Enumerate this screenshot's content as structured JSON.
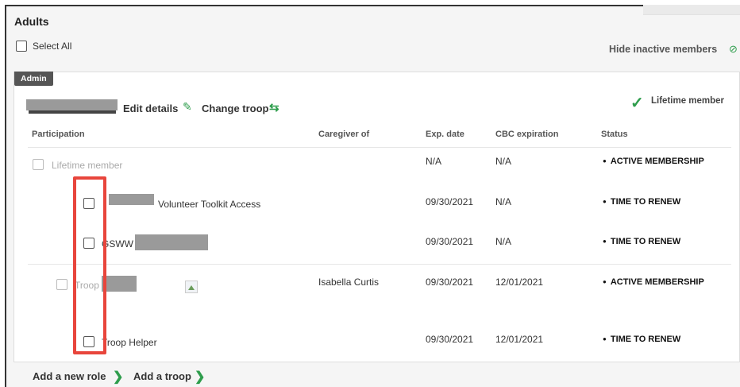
{
  "section": {
    "title": "Adults"
  },
  "select_all": {
    "label": "Select All",
    "checked": false
  },
  "hide_inactive": {
    "label": "Hide inactive members",
    "icon": "eye-slash-icon"
  },
  "member": {
    "role_badge": "Admin",
    "edit_details": "Edit details",
    "change_troop": "Change troop",
    "lifetime_member": "Lifetime member"
  },
  "table": {
    "headers": [
      "Participation",
      "Caregiver of",
      "Exp. date",
      "CBC expiration",
      "Status"
    ],
    "rows": [
      {
        "participation": "Lifetime member",
        "caregiver": "",
        "exp_date": "N/A",
        "cbc": "N/A",
        "status": "ACTIVE MEMBERSHIP"
      },
      {
        "participation": "Volunteer Toolkit Access",
        "caregiver": "",
        "exp_date": "09/30/2021",
        "cbc": "N/A",
        "status": "TIME TO RENEW"
      },
      {
        "participation": "GSWW",
        "caregiver": "",
        "exp_date": "09/30/2021",
        "cbc": "N/A",
        "status": "TIME TO RENEW"
      },
      {
        "participation": "Troop",
        "caregiver": "Isabella Curtis",
        "exp_date": "09/30/2021",
        "cbc": "12/01/2021",
        "status": "ACTIVE MEMBERSHIP"
      },
      {
        "participation": "Troop Helper",
        "caregiver": "",
        "exp_date": "09/30/2021",
        "cbc": "12/01/2021",
        "status": "TIME TO RENEW"
      }
    ]
  },
  "footer": {
    "add_role": "Add a new role",
    "add_troop": "Add a troop"
  },
  "colors": {
    "accent": "#2e9d4c",
    "highlight": "#e8453c",
    "badge": "#555555"
  }
}
